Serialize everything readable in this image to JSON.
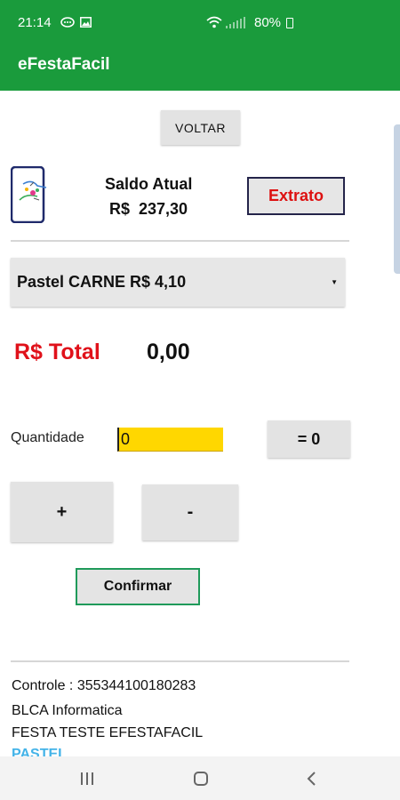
{
  "status_bar": {
    "time": "21:14",
    "battery": "80%",
    "icons": [
      "message-icon",
      "gallery-icon",
      "wifi-icon",
      "signal-icon",
      "battery-icon"
    ]
  },
  "app_bar": {
    "title": "eFestaFacil"
  },
  "back_button": {
    "label": "VOLTAR"
  },
  "balance": {
    "label": "Saldo Atual",
    "value": "R$  237,30",
    "statement_button": "Extrato"
  },
  "product_select": {
    "selected": "Pastel CARNE R$ 4,10"
  },
  "total": {
    "label": "R$ Total",
    "value": "0,00"
  },
  "quantity": {
    "label": "Quantidade",
    "value": "0",
    "result_button": "= 0",
    "plus_button": "+",
    "minus_button": "-"
  },
  "confirm_button": "Confirmar",
  "info": {
    "control": "Controle : 355344100180283",
    "company": "BLCA Informatica",
    "event": "FESTA TESTE EFESTAFACIL",
    "category": "PASTEL"
  },
  "colors": {
    "brand_green": "#1a9b3c",
    "total_red": "#e0111a",
    "input_yellow": "#ffd700",
    "link_blue": "#43b3e8"
  }
}
